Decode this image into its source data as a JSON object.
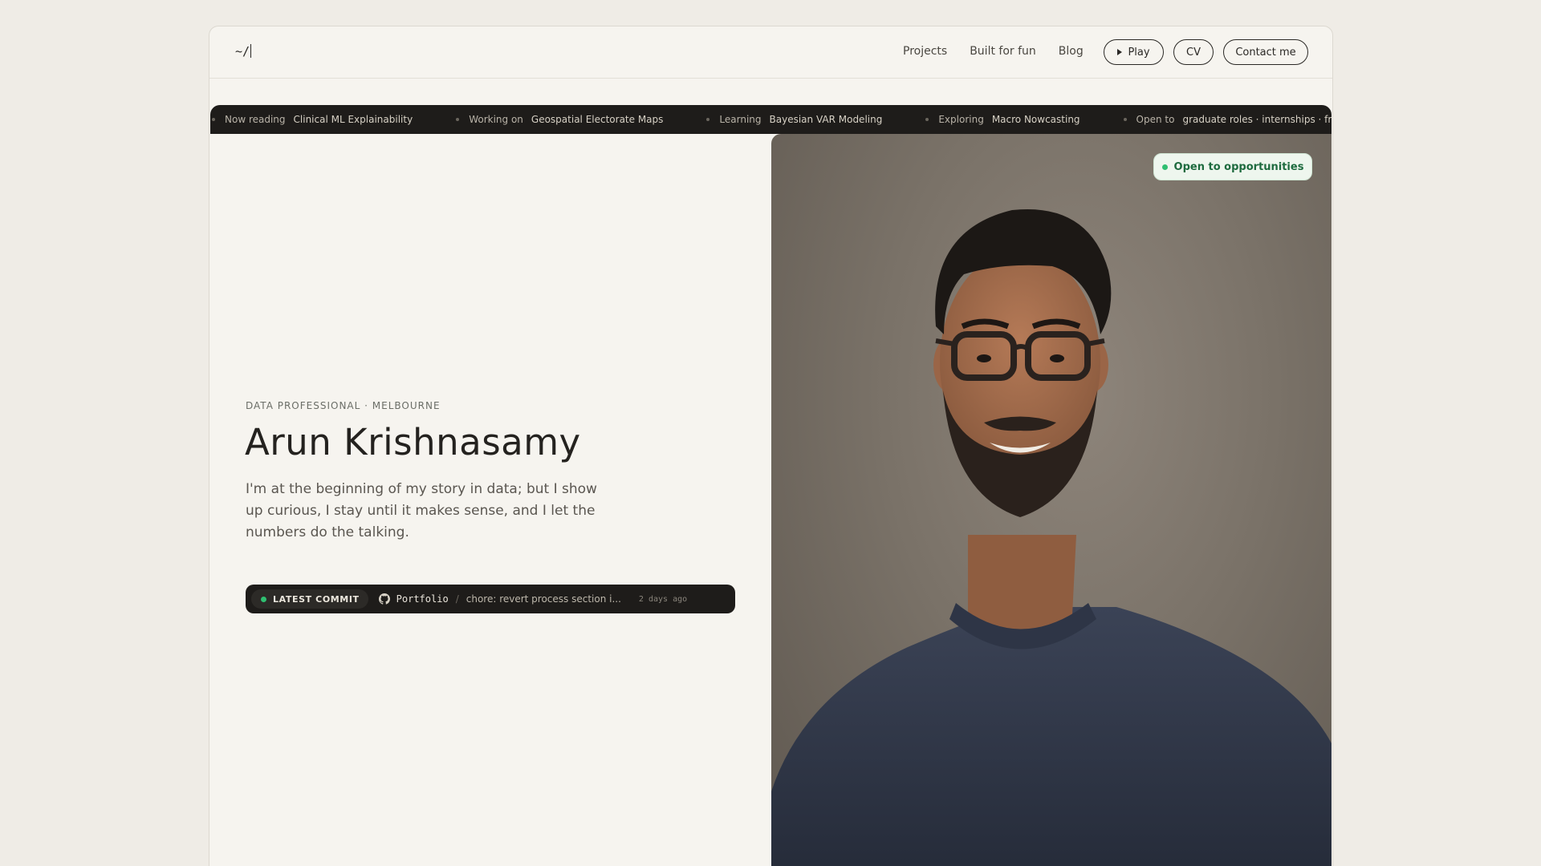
{
  "nav": {
    "logo": "~/",
    "links": [
      "Projects",
      "Built for fun",
      "Blog"
    ],
    "play_label": "Play",
    "cv_label": "CV",
    "contact_label": "Contact me"
  },
  "ticker": [
    {
      "label": "Now reading",
      "value": "Clinical ML Explainability"
    },
    {
      "label": "Working on",
      "value": "Geospatial Electorate Maps"
    },
    {
      "label": "Learning",
      "value": "Bayesian VAR Modeling"
    },
    {
      "label": "Exploring",
      "value": "Macro Nowcasting"
    },
    {
      "label": "Open to",
      "value": "graduate roles · internships · freelance"
    }
  ],
  "hero": {
    "eyebrow": "DATA PROFESSIONAL · MELBOURNE",
    "name": "Arun Krishnasamy",
    "bio": "I'm at the beginning of my story in data; but I show up curious, I stay until it makes sense, and I let the numbers do the talking."
  },
  "commit": {
    "badge": "LATEST COMMIT",
    "repo": "Portfolio",
    "separator": "/",
    "message": "chore: revert process section i...",
    "time": "2 days ago"
  },
  "photo": {
    "status": "Open to opportunities",
    "status_color": "#2fbf71"
  }
}
